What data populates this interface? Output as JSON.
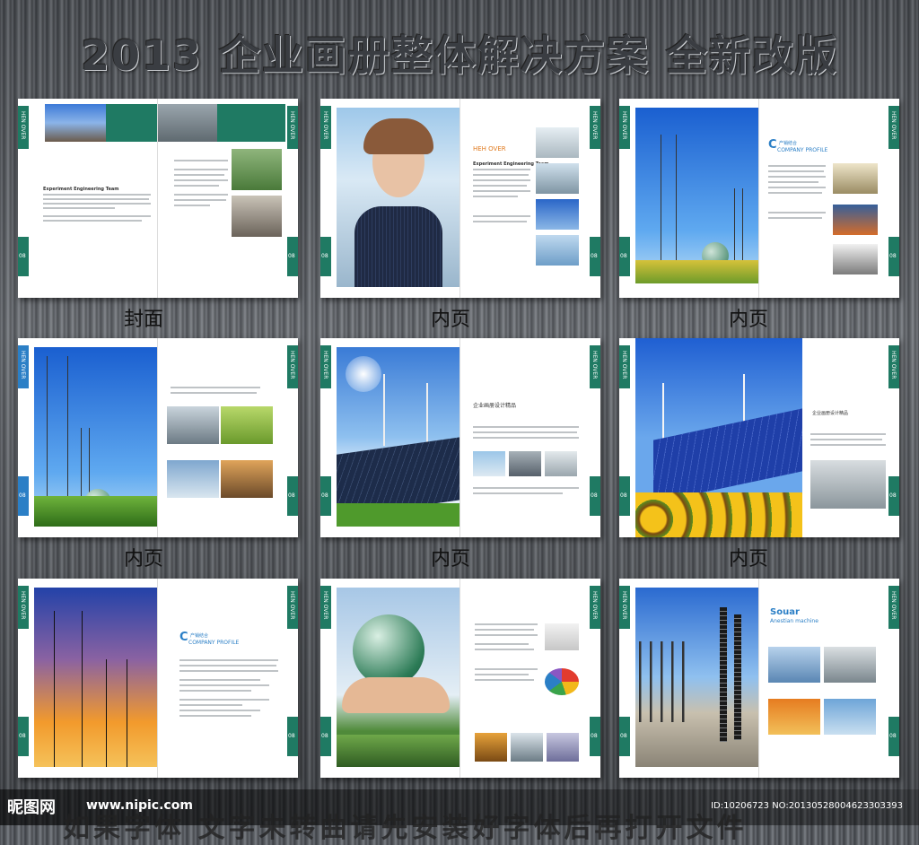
{
  "headline": "2013 企业画册整体解决方案  全新改版",
  "captions": {
    "row1_col1": "封面",
    "row1_col2": "内页",
    "row1_col3": "内页",
    "row2_col1": "内页",
    "row2_col2": "内页",
    "row2_col3": "内页"
  },
  "brochure_text": {
    "tab_label": "HEN OVER",
    "page_number": "08",
    "heh_over": "HEH OVER",
    "company_profile": "COMPANY PROFILE",
    "company_profile_cn": "产销结合",
    "souar": "Souar",
    "anestian": "Anestian machine",
    "experiment_title": "Experiment Engineering Team",
    "design_cn": "企业画册设计精品"
  },
  "footer": {
    "logo": "昵图网",
    "url": "www.nipic.com",
    "id": "ID:10206723 NO:20130528004623303393",
    "note": "如果字体 文字未转曲请先安装好字体后再打开文件"
  },
  "colors": {
    "accent_green": "#1f7a63",
    "accent_blue": "#2b7fc6"
  }
}
